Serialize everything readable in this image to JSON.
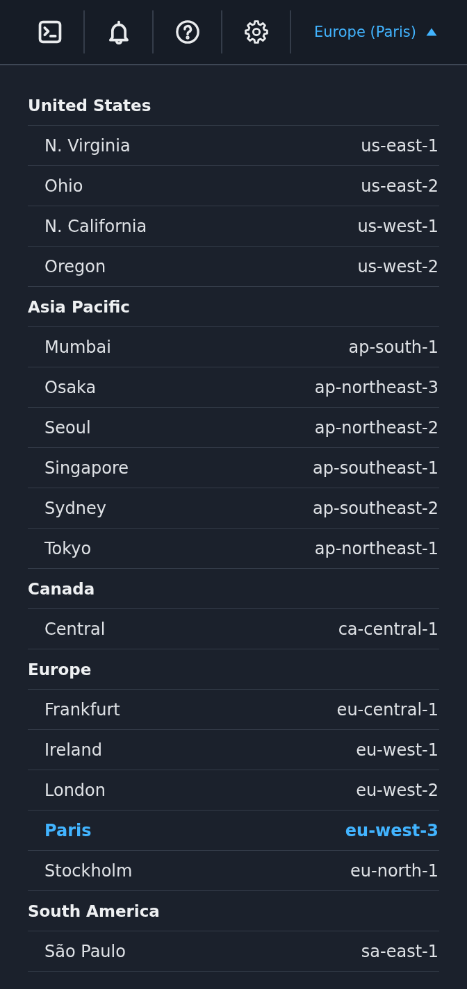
{
  "top_bar": {
    "icon_buttons": [
      {
        "kind": "terminal"
      },
      {
        "kind": "notifications"
      },
      {
        "kind": "help"
      },
      {
        "kind": "settings"
      }
    ],
    "region_button": {
      "label": "Europe (Paris)",
      "expanded": true
    }
  },
  "region_menu": {
    "groups": [
      {
        "label": "United States",
        "items": [
          {
            "name": "N. Virginia",
            "code": "us-east-1",
            "selected": false
          },
          {
            "name": "Ohio",
            "code": "us-east-2",
            "selected": false
          },
          {
            "name": "N. California",
            "code": "us-west-1",
            "selected": false
          },
          {
            "name": "Oregon",
            "code": "us-west-2",
            "selected": false
          }
        ]
      },
      {
        "label": "Asia Pacific",
        "items": [
          {
            "name": "Mumbai",
            "code": "ap-south-1",
            "selected": false
          },
          {
            "name": "Osaka",
            "code": "ap-northeast-3",
            "selected": false
          },
          {
            "name": "Seoul",
            "code": "ap-northeast-2",
            "selected": false
          },
          {
            "name": "Singapore",
            "code": "ap-southeast-1",
            "selected": false
          },
          {
            "name": "Sydney",
            "code": "ap-southeast-2",
            "selected": false
          },
          {
            "name": "Tokyo",
            "code": "ap-northeast-1",
            "selected": false
          }
        ]
      },
      {
        "label": "Canada",
        "items": [
          {
            "name": "Central",
            "code": "ca-central-1",
            "selected": false
          }
        ]
      },
      {
        "label": "Europe",
        "items": [
          {
            "name": "Frankfurt",
            "code": "eu-central-1",
            "selected": false
          },
          {
            "name": "Ireland",
            "code": "eu-west-1",
            "selected": false
          },
          {
            "name": "London",
            "code": "eu-west-2",
            "selected": false
          },
          {
            "name": "Paris",
            "code": "eu-west-3",
            "selected": true
          },
          {
            "name": "Stockholm",
            "code": "eu-north-1",
            "selected": false
          }
        ]
      },
      {
        "label": "South America",
        "items": [
          {
            "name": "São Paulo",
            "code": "sa-east-1",
            "selected": false
          }
        ]
      }
    ]
  }
}
